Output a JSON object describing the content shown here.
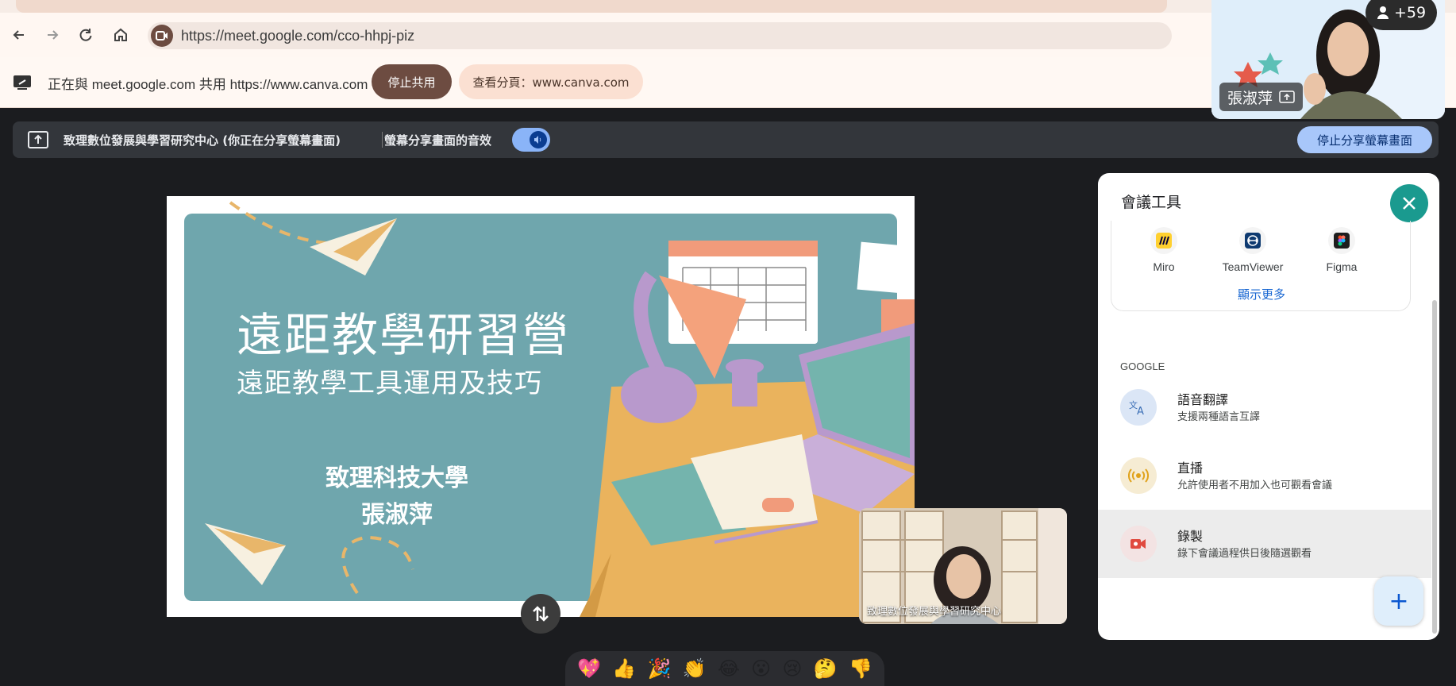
{
  "browser": {
    "url": "https://meet.google.com/cco-hhpj-piz"
  },
  "infobar": {
    "message": "正在與 meet.google.com 共用 https://www.canva.com",
    "stop_sharing": "停止共用",
    "view_tab": "查看分頁：www.canva.com"
  },
  "sharebar": {
    "title": "致理數位發展與學習研究中心 (你正在分享螢幕畫面)",
    "audio_label": "螢幕分享畫面的音效",
    "stop_presenting": "停止分享螢幕畫面"
  },
  "slide": {
    "title": "遠距教學研習營",
    "subtitle": "遠距教學工具運用及技巧",
    "org": "致理科技大學",
    "name": "張淑萍"
  },
  "self_view": {
    "label": "致理數位發展與學習研究中心"
  },
  "presenter": {
    "name": "張淑萍",
    "participant_count": "+59"
  },
  "panel": {
    "title": "會議工具",
    "apps": [
      {
        "label": "Miro",
        "icon": "miro-icon"
      },
      {
        "label": "TeamViewer",
        "icon": "teamviewer-icon"
      },
      {
        "label": "Figma",
        "icon": "figma-icon"
      }
    ],
    "show_more": "顯示更多",
    "section": "GOOGLE",
    "tools": [
      {
        "title": "語音翻譯",
        "desc": "支援兩種語言互譯",
        "icon": "translate-icon"
      },
      {
        "title": "直播",
        "desc": "允許使用者不用加入也可觀看會議",
        "icon": "broadcast-icon"
      },
      {
        "title": "錄製",
        "desc": "錄下會議過程供日後隨選觀看",
        "icon": "record-icon"
      }
    ],
    "add": "+"
  },
  "reactions": [
    "💖",
    "👍",
    "🎉",
    "👏",
    "😂",
    "😮",
    "😢",
    "🤔",
    "👎"
  ],
  "colors": {
    "accent_teal": "#1a9a8f",
    "stop_share_brown": "#6d4c41",
    "present_blue": "#a8c7fa"
  }
}
